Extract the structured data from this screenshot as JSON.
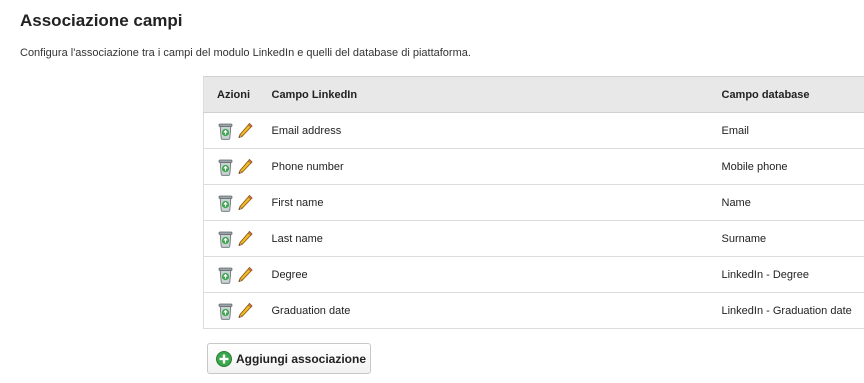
{
  "page": {
    "title": "Associazione campi",
    "description": "Configura l'associazione tra i campi del modulo LinkedIn e quelli del database di piattaforma."
  },
  "table": {
    "headers": {
      "actions": "Azioni",
      "linkedin": "Campo LinkedIn",
      "database": "Campo database"
    },
    "rows": [
      {
        "linkedin": "Email address",
        "database": "Email"
      },
      {
        "linkedin": "Phone number",
        "database": "Mobile phone"
      },
      {
        "linkedin": "First name",
        "database": "Name"
      },
      {
        "linkedin": "Last name",
        "database": "Surname"
      },
      {
        "linkedin": "Degree",
        "database": "LinkedIn - Degree"
      },
      {
        "linkedin": "Graduation date",
        "database": "LinkedIn - Graduation date"
      }
    ],
    "row_icons": [
      "trash-icon",
      "pencil-icon"
    ]
  },
  "actions": {
    "add_label": "Aggiungi associazione",
    "add_icon": "plus-circle-icon"
  },
  "colors": {
    "header_bg": "#e8e8e8",
    "add_icon_green": "#3aa64a"
  }
}
